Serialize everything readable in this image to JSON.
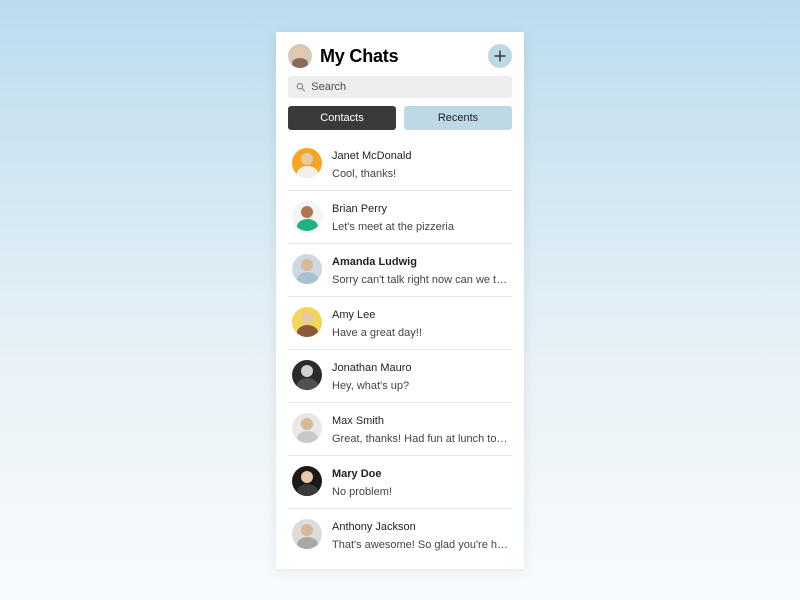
{
  "header": {
    "title": "My Chats"
  },
  "search": {
    "placeholder": "Search"
  },
  "tabs": {
    "contacts": "Contacts",
    "recents": "Recents",
    "active": "contacts"
  },
  "chats": [
    {
      "name": "Janet McDonald",
      "message": "Cool, thanks!",
      "unread": false,
      "avatar_bg": "#f5a623",
      "head": "#e8c8a8",
      "body": "#f0f0f0"
    },
    {
      "name": "Brian Perry",
      "message": "Let's meet at the pizzeria",
      "unread": false,
      "avatar_bg": "#f5f5f5",
      "head": "#b07850",
      "body": "#1db37a"
    },
    {
      "name": "Amanda Ludwig",
      "message": "Sorry can't talk right now can we talk later about the project",
      "unread": true,
      "avatar_bg": "#cfd8e0",
      "head": "#d8b898",
      "body": "#a8c0d0"
    },
    {
      "name": "Amy Lee",
      "message": "Have a great day!!",
      "unread": false,
      "avatar_bg": "#f3d557",
      "head": "#e8c8a8",
      "body": "#8a5a3a"
    },
    {
      "name": "Jonathan Mauro",
      "message": "Hey, what's up?",
      "unread": false,
      "avatar_bg": "#2a2a2a",
      "head": "#d0d0d0",
      "body": "#505050"
    },
    {
      "name": "Max Smith",
      "message": "Great, thanks! Had fun at lunch today with everyone",
      "unread": false,
      "avatar_bg": "#e8e8e8",
      "head": "#d8b898",
      "body": "#c8c8c8"
    },
    {
      "name": "Mary Doe",
      "message": "No problem!",
      "unread": true,
      "avatar_bg": "#1a1a1a",
      "head": "#e8c8a8",
      "body": "#3a3a3a"
    },
    {
      "name": "Anthony Jackson",
      "message": "That's awesome! So glad you're having a good time there",
      "unread": false,
      "avatar_bg": "#dcdcdc",
      "head": "#d8b898",
      "body": "#a8a8a8"
    }
  ]
}
